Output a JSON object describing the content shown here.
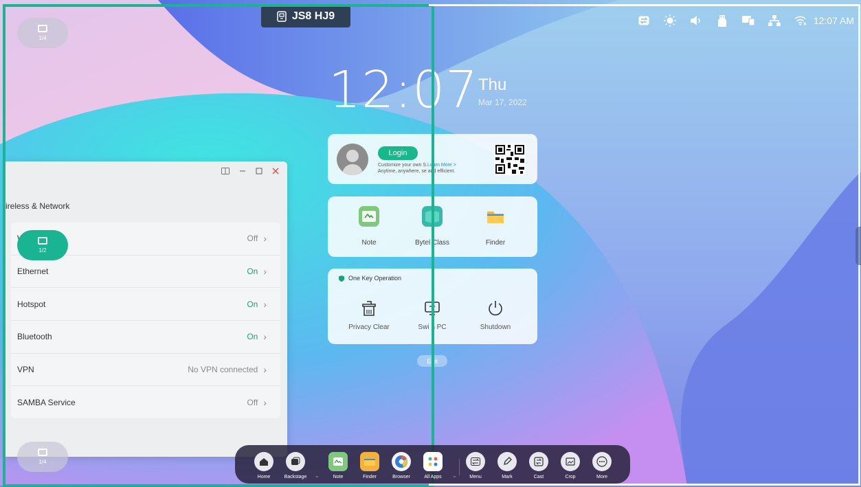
{
  "room_badge": {
    "icon": "classroom-icon",
    "text": "JS8 HJ9"
  },
  "status_bar": {
    "icons": [
      "switch-icon",
      "brightness-icon",
      "volume-icon",
      "usb-icon",
      "screen-share-icon",
      "network-icon",
      "wifi-icon"
    ],
    "time": "12:07 AM"
  },
  "clock": {
    "time": "12:07",
    "day": "Thu",
    "date": "Mar 17, 2022"
  },
  "login_card": {
    "button": "Login",
    "desc_line1": "Customize your own ",
    "desc_line1b": "S.",
    "desc_learn_more": "Learn More >",
    "desc_line2": "Anytime, anywhere, s",
    "desc_line2b": "e and efficient."
  },
  "apps_card": {
    "apps": [
      {
        "label": "Note",
        "icon": "note-icon",
        "color": "#7fc97f"
      },
      {
        "label": "Bytel",
        "label_b": "Class",
        "icon": "class-icon",
        "color": "#36b9a8"
      },
      {
        "label": "Finder",
        "icon": "folder-icon",
        "color": "#f4b23a"
      }
    ]
  },
  "onekey_card": {
    "title": "One Key Operation",
    "items": [
      {
        "label": "Privacy Clear",
        "icon": "privacy-clear-icon"
      },
      {
        "label": "Swi",
        "label_b": "h PC",
        "icon": "switch-pc-icon"
      },
      {
        "label": "Shutdown",
        "icon": "power-icon"
      }
    ]
  },
  "edit_button": "Edit",
  "settings": {
    "section_title": "ireless & Network",
    "rows": [
      {
        "label": "W",
        "value": "Off",
        "on": false
      },
      {
        "label": "Ethernet",
        "value": "On",
        "on": true
      },
      {
        "label": "Hotspot",
        "value": "On",
        "on": true
      },
      {
        "label": "Bluetooth",
        "value": "On",
        "on": true
      },
      {
        "label": "VPN",
        "value": "No VPN connected",
        "on": false
      },
      {
        "label": "SAMBA Service",
        "value": "Off",
        "on": false
      }
    ]
  },
  "page_indicators": {
    "top": "1/4",
    "middle": "1/2",
    "bottom": "1/4"
  },
  "dock": {
    "items": [
      {
        "label": "Home",
        "icon": "home-icon"
      },
      {
        "label": "Backstage",
        "icon": "backstage-icon"
      },
      {
        "label": "Note",
        "icon": "note-icon"
      },
      {
        "label": "Finder",
        "icon": "folder-icon"
      },
      {
        "label": "Browser",
        "icon": "browser-icon"
      },
      {
        "label": "All Apps",
        "icon": "all-apps-icon"
      },
      {
        "label": "Menu",
        "icon": "menu-icon"
      },
      {
        "label": "Mark",
        "icon": "mark-icon"
      },
      {
        "label": "Cast",
        "icon": "cast-icon"
      },
      {
        "label": "Crop",
        "icon": "crop-icon"
      },
      {
        "label": "More",
        "icon": "more-icon"
      }
    ]
  }
}
